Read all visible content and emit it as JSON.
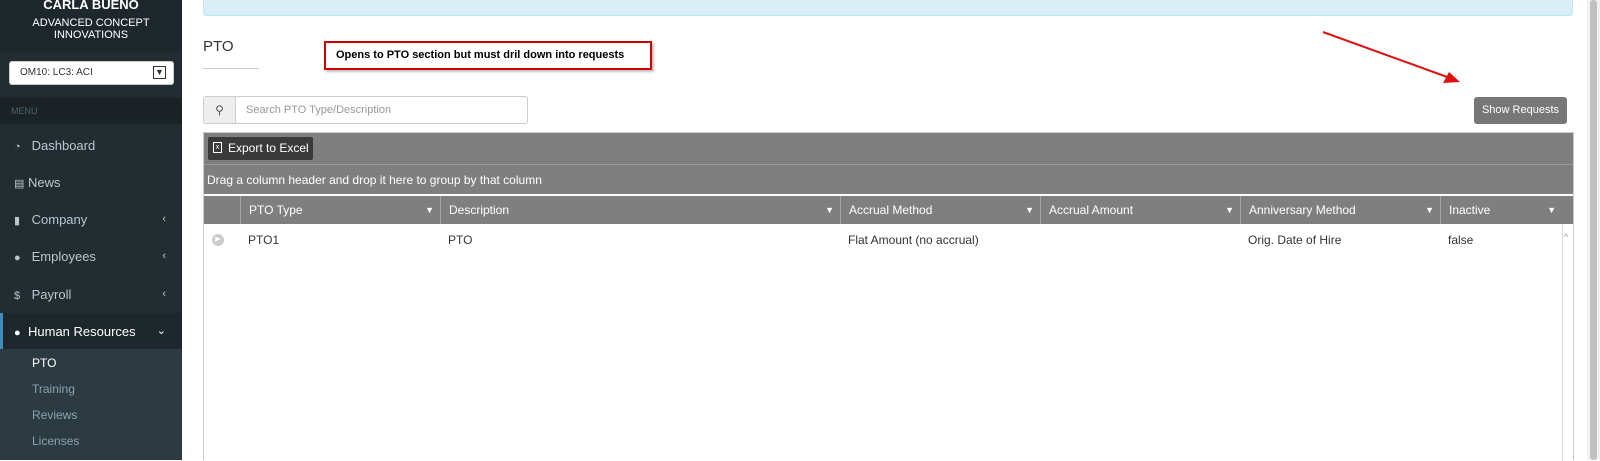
{
  "sidebar": {
    "user_name": "CARLA BUENO",
    "company_name": "ADVANCED CONCEPT INNOVATIONS",
    "company_select": "OM10: LC3: ACI",
    "menu_header": "MENU",
    "nav": [
      {
        "label": "Dashboard",
        "icon": "dashboard-icon"
      },
      {
        "label": "News",
        "icon": "newspaper-icon"
      },
      {
        "label": "Company",
        "icon": "building-icon"
      },
      {
        "label": "Employees",
        "icon": "user-icon"
      },
      {
        "label": "Payroll",
        "icon": "dollar-icon"
      },
      {
        "label": "Human Resources",
        "icon": "users-icon"
      }
    ],
    "submenu": [
      "PTO",
      "Training",
      "Reviews",
      "Licenses"
    ]
  },
  "main": {
    "title": "PTO",
    "annotation": "Opens to PTO section but must dril down into requests",
    "search_placeholder": "Search PTO Type/Description",
    "search_value": "",
    "show_requests_label": "Show Requests"
  },
  "grid": {
    "export_label": "Export to Excel",
    "group_hint": "Drag a column header and drop it here to group by that column",
    "columns": [
      "PTO Type",
      "Description",
      "Accrual Method",
      "Accrual Amount",
      "Anniversary Method",
      "Inactive"
    ],
    "rows": [
      [
        "PTO1",
        "PTO",
        "Flat Amount (no accrual)",
        "",
        "Orig. Date of Hire",
        "false"
      ]
    ]
  },
  "colors": {
    "sidebar_bg": "#222d32",
    "grid_header": "#7f7f7f",
    "annotation_border": "#cc0000",
    "alert_bg": "#d9edf7"
  }
}
